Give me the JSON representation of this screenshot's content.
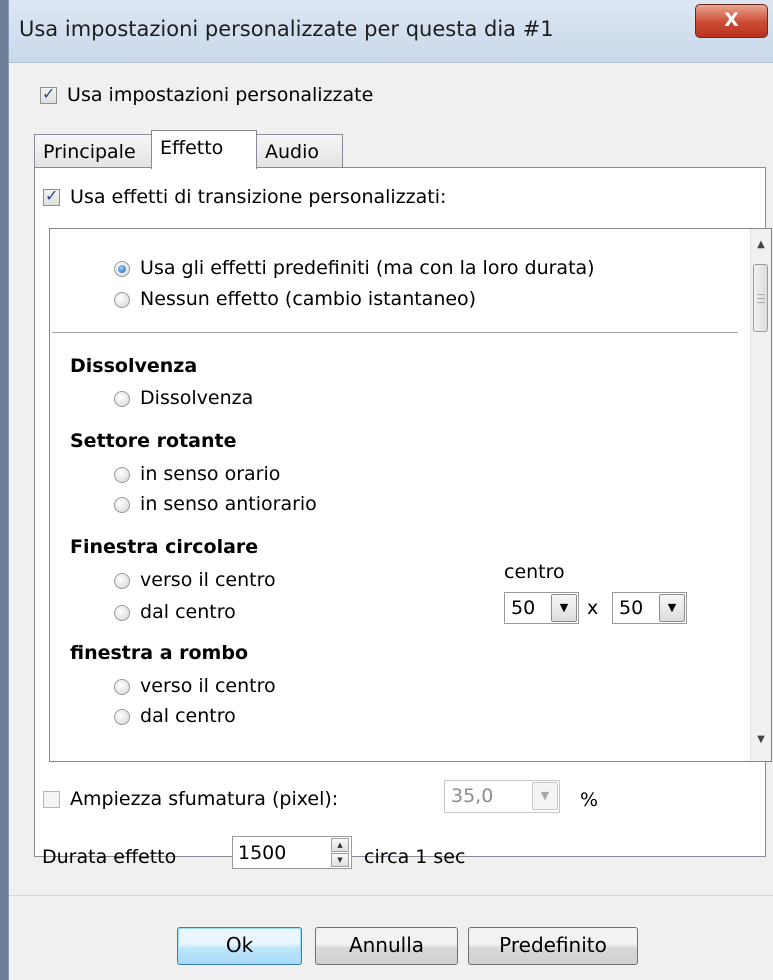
{
  "window": {
    "title": "Usa impostazioni personalizzate per questa dia #1",
    "close_label": "X"
  },
  "custom_settings": {
    "label": "Usa impostazioni personalizzate",
    "checked": true
  },
  "tabs": [
    {
      "label": "Principale",
      "active": false
    },
    {
      "label": "Effetto",
      "active": true
    },
    {
      "label": "Audio",
      "active": false
    }
  ],
  "effect_tab": {
    "custom_transition": {
      "label": "Usa effetti di transizione personalizzati:",
      "checked": true
    },
    "list": {
      "top_options": [
        {
          "label": "Usa gli effetti predefiniti (ma con la loro durata)",
          "selected": true
        },
        {
          "label": "Nessun effetto (cambio istantaneo)",
          "selected": false
        }
      ],
      "groups": [
        {
          "heading": "Dissolvenza",
          "options": [
            "Dissolvenza"
          ]
        },
        {
          "heading": "Settore rotante",
          "options": [
            "in senso orario",
            "in senso antiorario"
          ]
        },
        {
          "heading": "Finestra circolare",
          "options": [
            "verso il centro",
            "dal centro"
          ]
        },
        {
          "heading": "finestra a rombo",
          "options": [
            "verso il centro",
            "dal centro"
          ]
        }
      ],
      "center": {
        "label": "centro",
        "x": "50",
        "separator": "x",
        "y": "50"
      }
    },
    "feather": {
      "label": "Ampiezza sfumatura (pixel):",
      "checked": false,
      "value": "35,0",
      "unit": "%"
    },
    "duration": {
      "label": "Durata effetto",
      "value": "1500",
      "hint": "circa 1 sec"
    }
  },
  "buttons": {
    "ok": "Ok",
    "cancel": "Annulla",
    "default": "Predefinito"
  }
}
